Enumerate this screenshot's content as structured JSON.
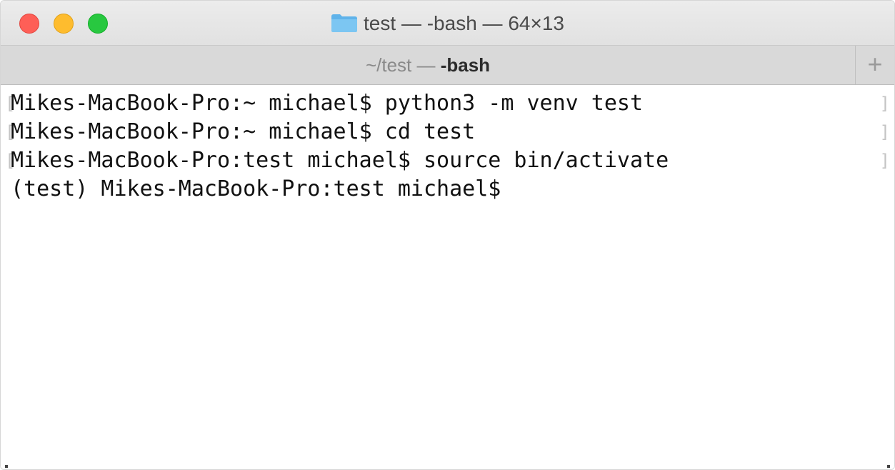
{
  "window": {
    "title": "test — -bash — 64×13",
    "folder_icon": "folder-icon",
    "traffic_lights": {
      "close_color": "#fe5f57",
      "minimize_color": "#febc2e",
      "zoom_color": "#28c840"
    }
  },
  "tab": {
    "path": "~/test — ",
    "process": "-bash",
    "new_tab_label": "+"
  },
  "terminal": {
    "lines": [
      "Mikes-MacBook-Pro:~ michael$ python3 -m venv test",
      "Mikes-MacBook-Pro:~ michael$ cd test",
      "Mikes-MacBook-Pro:test michael$ source bin/activate",
      "(test) Mikes-MacBook-Pro:test michael$"
    ],
    "left_mark": "[",
    "right_mark": "]"
  }
}
